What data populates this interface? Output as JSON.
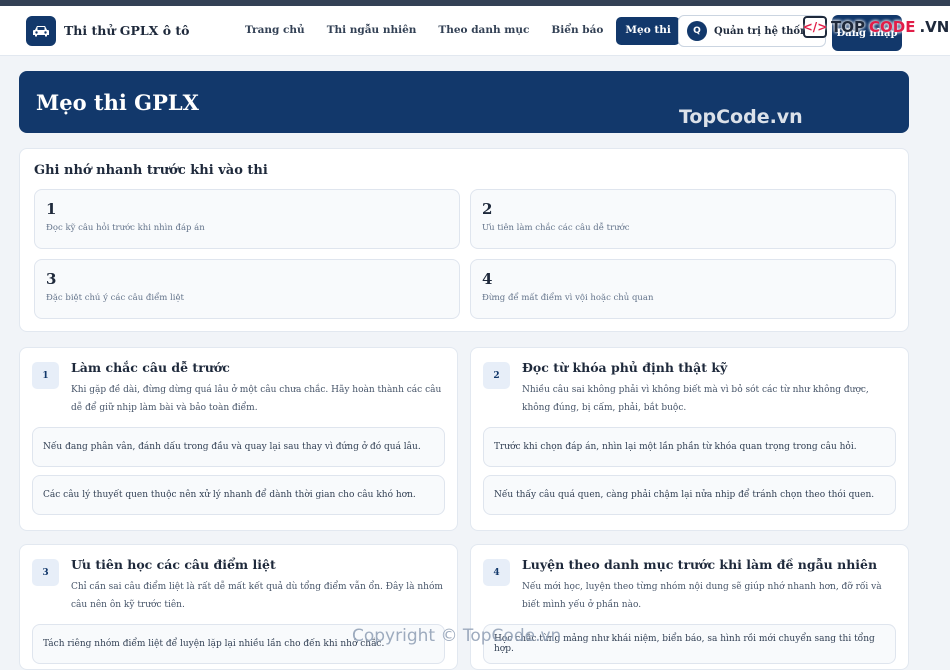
{
  "navbar": {
    "brand": "Thi thử GPLX ô tô",
    "items": [
      {
        "label": "Trang chủ",
        "active": false
      },
      {
        "label": "Thi ngẫu nhiên",
        "active": false
      },
      {
        "label": "Theo danh mục",
        "active": false
      },
      {
        "label": "Biển báo",
        "active": false
      },
      {
        "label": "Mẹo thi",
        "active": true
      }
    ],
    "admin_initial": "Q",
    "admin_label": "Quản trị hệ thống",
    "login_label": "Đăng nhập"
  },
  "watermark": {
    "logo_prefix": "TOP",
    "logo_highlight": "CODE",
    "logo_suffix": ".VN",
    "logo_icon_text": "</>",
    "site_text": "TopCode.vn",
    "copyright": "Copyright © TopCode.vn"
  },
  "hero": {
    "title": "Mẹo thi GPLX"
  },
  "quick": {
    "title": "Ghi nhớ nhanh trước khi vào thi",
    "tips": [
      {
        "num": "1",
        "text": "Đọc kỹ câu hỏi trước khi nhìn đáp án"
      },
      {
        "num": "2",
        "text": "Ưu tiên làm chắc các câu dễ trước"
      },
      {
        "num": "3",
        "text": "Đặc biệt chú ý các câu điểm liệt"
      },
      {
        "num": "4",
        "text": "Đừng để mất điểm vì vội hoặc chủ quan"
      }
    ]
  },
  "cards": [
    {
      "num": "1",
      "title": "Làm chắc câu dễ trước",
      "desc": "Khi gặp đề dài, đừng dừng quá lâu ở một câu chưa chắc. Hãy hoàn thành các câu dễ để giữ nhịp làm bài và bảo toàn điểm.",
      "notes": [
        "Nếu đang phân vân, đánh dấu trong đầu và quay lại sau thay vì đứng ở đó quá lâu.",
        "Các câu lý thuyết quen thuộc nên xử lý nhanh để dành thời gian cho câu khó hơn."
      ]
    },
    {
      "num": "2",
      "title": "Đọc từ khóa phủ định thật kỹ",
      "desc": "Nhiều câu sai không phải vì không biết mà vì bỏ sót các từ như không được, không đúng, bị cấm, phải, bắt buộc.",
      "notes": [
        "Trước khi chọn đáp án, nhìn lại một lần phần từ khóa quan trọng trong câu hỏi.",
        "Nếu thấy câu quá quen, càng phải chậm lại nửa nhịp để tránh chọn theo thói quen."
      ]
    },
    {
      "num": "3",
      "title": "Ưu tiên học các câu điểm liệt",
      "desc": "Chỉ cần sai câu điểm liệt là rất dễ mất kết quả dù tổng điểm vẫn ổn. Đây là nhóm câu nên ôn kỹ trước tiên.",
      "notes": [
        "Tách riêng nhóm điểm liệt để luyện lặp lại nhiều lần cho đến khi nhớ chắc."
      ]
    },
    {
      "num": "4",
      "title": "Luyện theo danh mục trước khi làm đề ngẫu nhiên",
      "desc": "Nếu mới học, luyện theo từng nhóm nội dung sẽ giúp nhớ nhanh hơn, đỡ rối và biết mình yếu ở phần nào.",
      "notes": [
        "Học chắc từng mảng như khái niệm, biển báo, sa hình rồi mới chuyển sang thi tổng hợp."
      ]
    }
  ]
}
